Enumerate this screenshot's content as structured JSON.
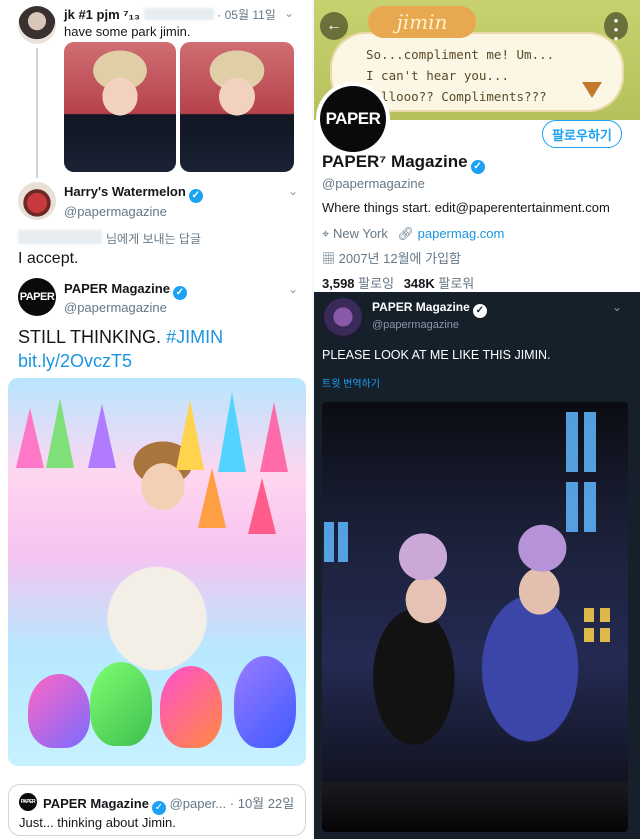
{
  "left": {
    "top_tweet": {
      "display_name": "jk #1 pjm ⁷₁₃",
      "date": "· 05월 11일",
      "text": "have some park jimin."
    },
    "reply": {
      "display_name": "Harry's Watermelon",
      "handle": "@papermagazine",
      "reply_note": "님에게 보내는 답글",
      "text": "I accept."
    },
    "main_tweet": {
      "display_name": "PAPER Magazine",
      "handle": "@papermagazine",
      "text_plain": "STILL THINKING.",
      "hashtag": "#JIMIN",
      "link": "bit.ly/2OvczT5"
    },
    "quoted": {
      "display_name": "PAPER Magazine",
      "handle": "@paper...",
      "date": "· 10월 22일",
      "text": "Just... thinking about Jimin."
    }
  },
  "right": {
    "profile": {
      "header_name_tag": "jimin",
      "header_lines": [
        "So...compliment me! Um...",
        "I can't hear you...",
        "Hellooo?? Compliments???"
      ],
      "avatar_text": "PAPER",
      "follow_label": "팔로우하기",
      "name": "PAPER⁷ Magazine",
      "handle": "@papermagazine",
      "bio": "Where things start. edit@paperentertainment.com",
      "location": "New York",
      "website": "papermag.com",
      "joined": "2007년 12월에 가입함",
      "following_count": "3,598",
      "following_label": "팔로잉",
      "followers_count": "348K",
      "followers_label": "팔로워"
    },
    "dark_tweet": {
      "display_name": "PAPER Magazine",
      "handle": "@papermagazine",
      "text": "PLEASE LOOK AT ME LIKE THIS JIMIN.",
      "translate": "트윗 번역하기"
    }
  },
  "colors": {
    "twitter_blue": "#1da1f2",
    "link_blue": "#1b95e0",
    "dark_bg": "#15202b"
  }
}
